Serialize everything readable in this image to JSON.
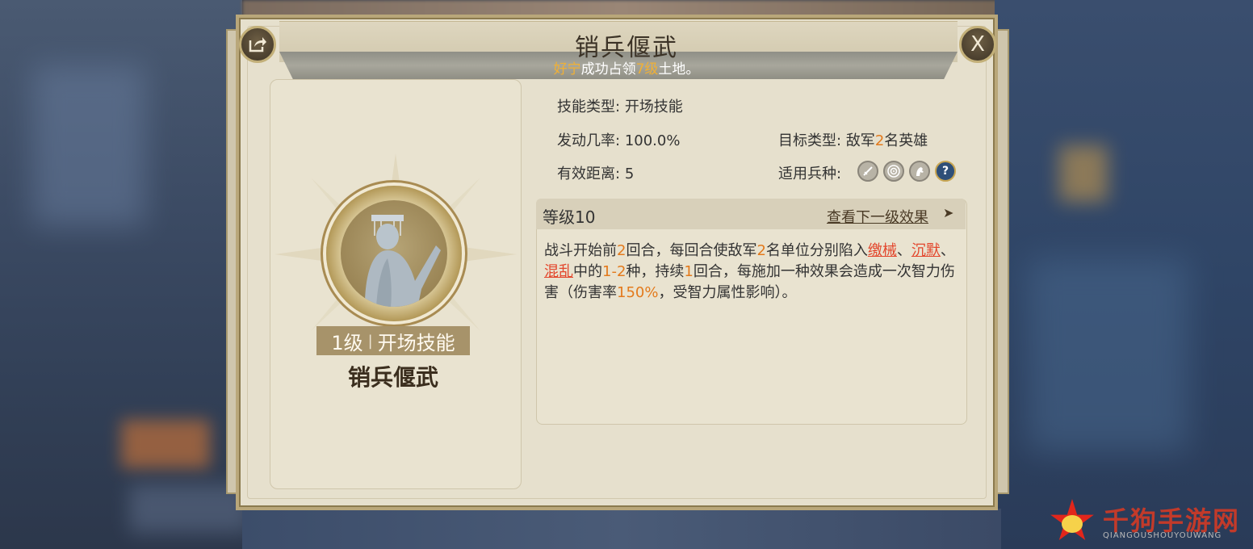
{
  "header": {
    "title": "销兵偃武",
    "subtitle": {
      "player": "好宁",
      "text1": "成功占领",
      "level": "7级",
      "text2": "土地。"
    }
  },
  "buttons": {
    "share_icon": "share-icon",
    "close_label": "X"
  },
  "skill_card": {
    "level_text": "1级",
    "separator": "|",
    "type_text": "开场技能",
    "name": "销兵偃武"
  },
  "info": {
    "skill_type_label": "技能类型:",
    "skill_type_value": "开场技能",
    "trigger_rate_label": "发动几率:",
    "trigger_rate_value": "100.0%",
    "distance_label": "有效距离:",
    "distance_value": "5",
    "target_label": "目标类型:",
    "target_prefix": "敌军",
    "target_count": "2",
    "target_suffix": "名英雄",
    "troop_label": "适用兵种:",
    "troops": [
      "spear-icon",
      "bow-icon",
      "cavalry-icon",
      "unknown-icon"
    ],
    "troop_unknown_glyph": "?"
  },
  "level_section": {
    "level_label": "等级10",
    "next_link": "查看下一级效果",
    "arrow": "➤"
  },
  "description": {
    "p1": "战斗开始前",
    "n1": "2",
    "p2": "回合，每回合使敌军",
    "n2": "2",
    "p3": "名单位分别陷入",
    "k1": "缴械",
    "p4": "、",
    "k2": "沉默",
    "p5": "、",
    "k3": "混乱",
    "p6": "中的",
    "n3": "1-2",
    "p7": "种，持续",
    "n4": "1",
    "p8": "回合，每施加一种效果会造成一次智力伤害（伤害率",
    "n5": "150%",
    "p9": "，受智力属性影响）。"
  },
  "watermark": {
    "text": "千狗手游网",
    "sub": "QIANGOUSHOUYOUWANG"
  },
  "colors": {
    "highlight_orange": "#e37a1c",
    "highlight_red": "#e3462c",
    "gold": "#f0b035"
  }
}
